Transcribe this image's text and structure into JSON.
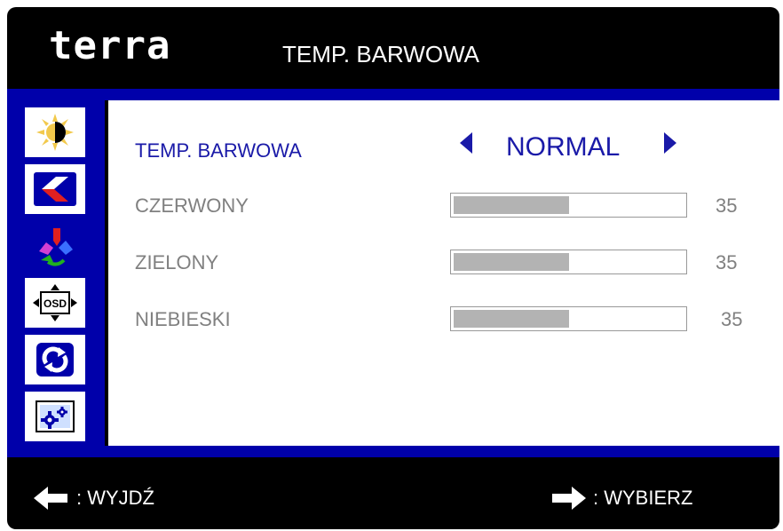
{
  "brand": "terra",
  "header": {
    "title": "TEMP. BARWOWA"
  },
  "sidebar": {
    "tabs": [
      {
        "icon": "brightness-contrast-icon",
        "active": false
      },
      {
        "icon": "image-position-icon",
        "active": false
      },
      {
        "icon": "color-settings-icon",
        "active": true
      },
      {
        "icon": "osd-settings-icon",
        "active": false
      },
      {
        "icon": "reset-icon",
        "active": false
      },
      {
        "icon": "misc-settings-icon",
        "active": false
      }
    ]
  },
  "menu": {
    "color_temp": {
      "label": "TEMP. BARWOWA",
      "value": "NORMAL"
    },
    "channels": [
      {
        "label": "CZERWONY",
        "value": "35",
        "level": 0.5
      },
      {
        "label": "ZIELONY",
        "value": "35",
        "level": 0.5
      },
      {
        "label": "NIEBIESKI",
        "value": "35",
        "level": 0.5
      }
    ]
  },
  "footer": {
    "exit_label": ": WYJDŹ",
    "select_label": ": WYBIERZ"
  },
  "colors": {
    "accent": "#0000aa",
    "selected_text": "#1a1aa8",
    "inactive_text": "#808080"
  }
}
